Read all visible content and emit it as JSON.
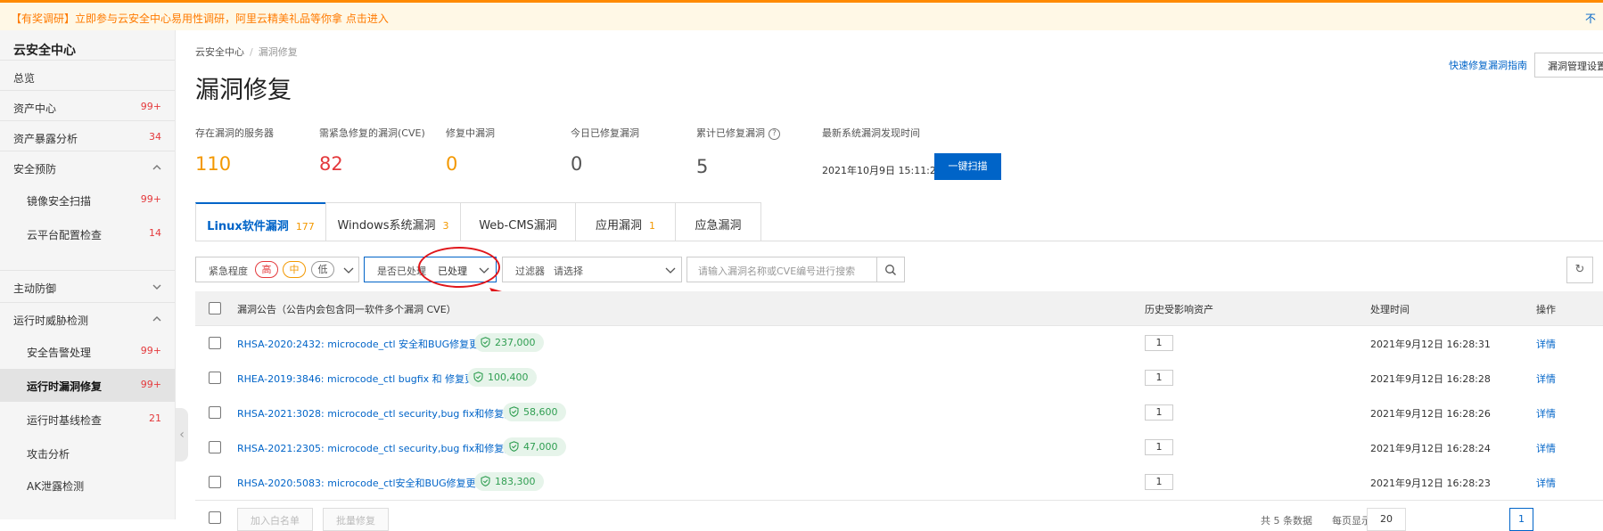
{
  "banner": {
    "text": "【有奖调研】立即参与云安全中心易用性调研，阿里云精美礼品等你拿 点击进入",
    "right_text": "不"
  },
  "sidebar": {
    "title": "云安全中心",
    "items": [
      {
        "label": "总览"
      },
      {
        "label": "资产中心",
        "count": "99+"
      },
      {
        "label": "资产暴露分析",
        "count": "34"
      },
      {
        "label": "安全预防"
      },
      {
        "label": "镜像安全扫描",
        "count": "99+"
      },
      {
        "label": "云平台配置检查",
        "count": "14"
      },
      {
        "label": "主动防御"
      },
      {
        "label": "运行时威胁检测"
      },
      {
        "label": "安全告警处理",
        "count": "99+"
      },
      {
        "label": "运行时漏洞修复",
        "count": "99+"
      },
      {
        "label": "运行时基线检查",
        "count": "21"
      },
      {
        "label": "攻击分析"
      },
      {
        "label": "AK泄露检测"
      }
    ]
  },
  "breadcrumb": {
    "root": "云安全中心",
    "sep": "/",
    "current": "漏洞修复"
  },
  "page_title": "漏洞修复",
  "header_actions": {
    "guide_link": "快速修复漏洞指南",
    "settings_button": "漏洞管理设置"
  },
  "stats": [
    {
      "label": "存在漏洞的服务器",
      "value": "110",
      "color": "#f39800"
    },
    {
      "label": "需紧急修复的漏洞(CVE)",
      "value": "82",
      "color": "#e4393c"
    },
    {
      "label": "修复中漏洞",
      "value": "0",
      "color": "#f39800"
    },
    {
      "label": "今日已修复漏洞",
      "value": "0",
      "color": "#555555"
    },
    {
      "label": "累计已修复漏洞",
      "value": "5",
      "color": "#555555",
      "help": "?"
    },
    {
      "label": "最新系统漏洞发现时间"
    }
  ],
  "latest_time": "2021年10月9日 15:11:22",
  "scan_button": "一键扫描",
  "tabs": [
    {
      "label": "Linux软件漏洞",
      "count": "177"
    },
    {
      "label": "Windows系统漏洞",
      "count": "3"
    },
    {
      "label": "Web-CMS漏洞",
      "count": ""
    },
    {
      "label": "应用漏洞",
      "count": "1"
    },
    {
      "label": "应急漏洞",
      "count": ""
    }
  ],
  "filters": {
    "urgency_label": "紧急程度",
    "urgency_high": "高",
    "urgency_mid": "中",
    "urgency_low": "低",
    "handled_label": "是否已处理",
    "handled_value": "已处理",
    "filter_label": "过滤器",
    "filter_value": "请选择",
    "search_placeholder": "请输入漏洞名称或CVE编号进行搜索"
  },
  "table": {
    "headers": {
      "title": "漏洞公告（公告内会包含同一软件多个漏洞 CVE）",
      "assets": "历史受影响资产",
      "time": "处理时间",
      "action": "操作"
    },
    "rows": [
      {
        "title": "RHSA-2020:2432: microcode_ctl 安全和BUG修复更新",
        "score": "237,000",
        "assets": "1",
        "time": "2021年9月12日 16:28:31",
        "action": "详情"
      },
      {
        "title": "RHEA-2019:3846: microcode_ctl bugfix 和 修复更新",
        "score": "100,400",
        "assets": "1",
        "time": "2021年9月12日 16:28:28",
        "action": "详情"
      },
      {
        "title": "RHSA-2021:3028: microcode_ctl security,bug fix和修复更新",
        "score": "58,600",
        "assets": "1",
        "time": "2021年9月12日 16:28:26",
        "action": "详情"
      },
      {
        "title": "RHSA-2021:2305: microcode_ctl security,bug fix和修复更新",
        "score": "47,000",
        "assets": "1",
        "time": "2021年9月12日 16:28:24",
        "action": "详情"
      },
      {
        "title": "RHSA-2020:5083: microcode_ctl安全和BUG修复更新",
        "score": "183,300",
        "assets": "1",
        "time": "2021年9月12日 16:28:23",
        "action": "详情"
      }
    ]
  },
  "footer": {
    "btn_whitelist": "加入白名单",
    "btn_batch": "批量修复",
    "total": "共 5 条数据",
    "per_page": "每页显示",
    "page_size": "20",
    "current_page": "1"
  },
  "colors": {
    "accent": "#0064c8",
    "banner_bg": "#fff8e6",
    "banner_text": "#ff7a00",
    "badge_bg": "#e6f4ea",
    "annotation": "#e0161b"
  }
}
